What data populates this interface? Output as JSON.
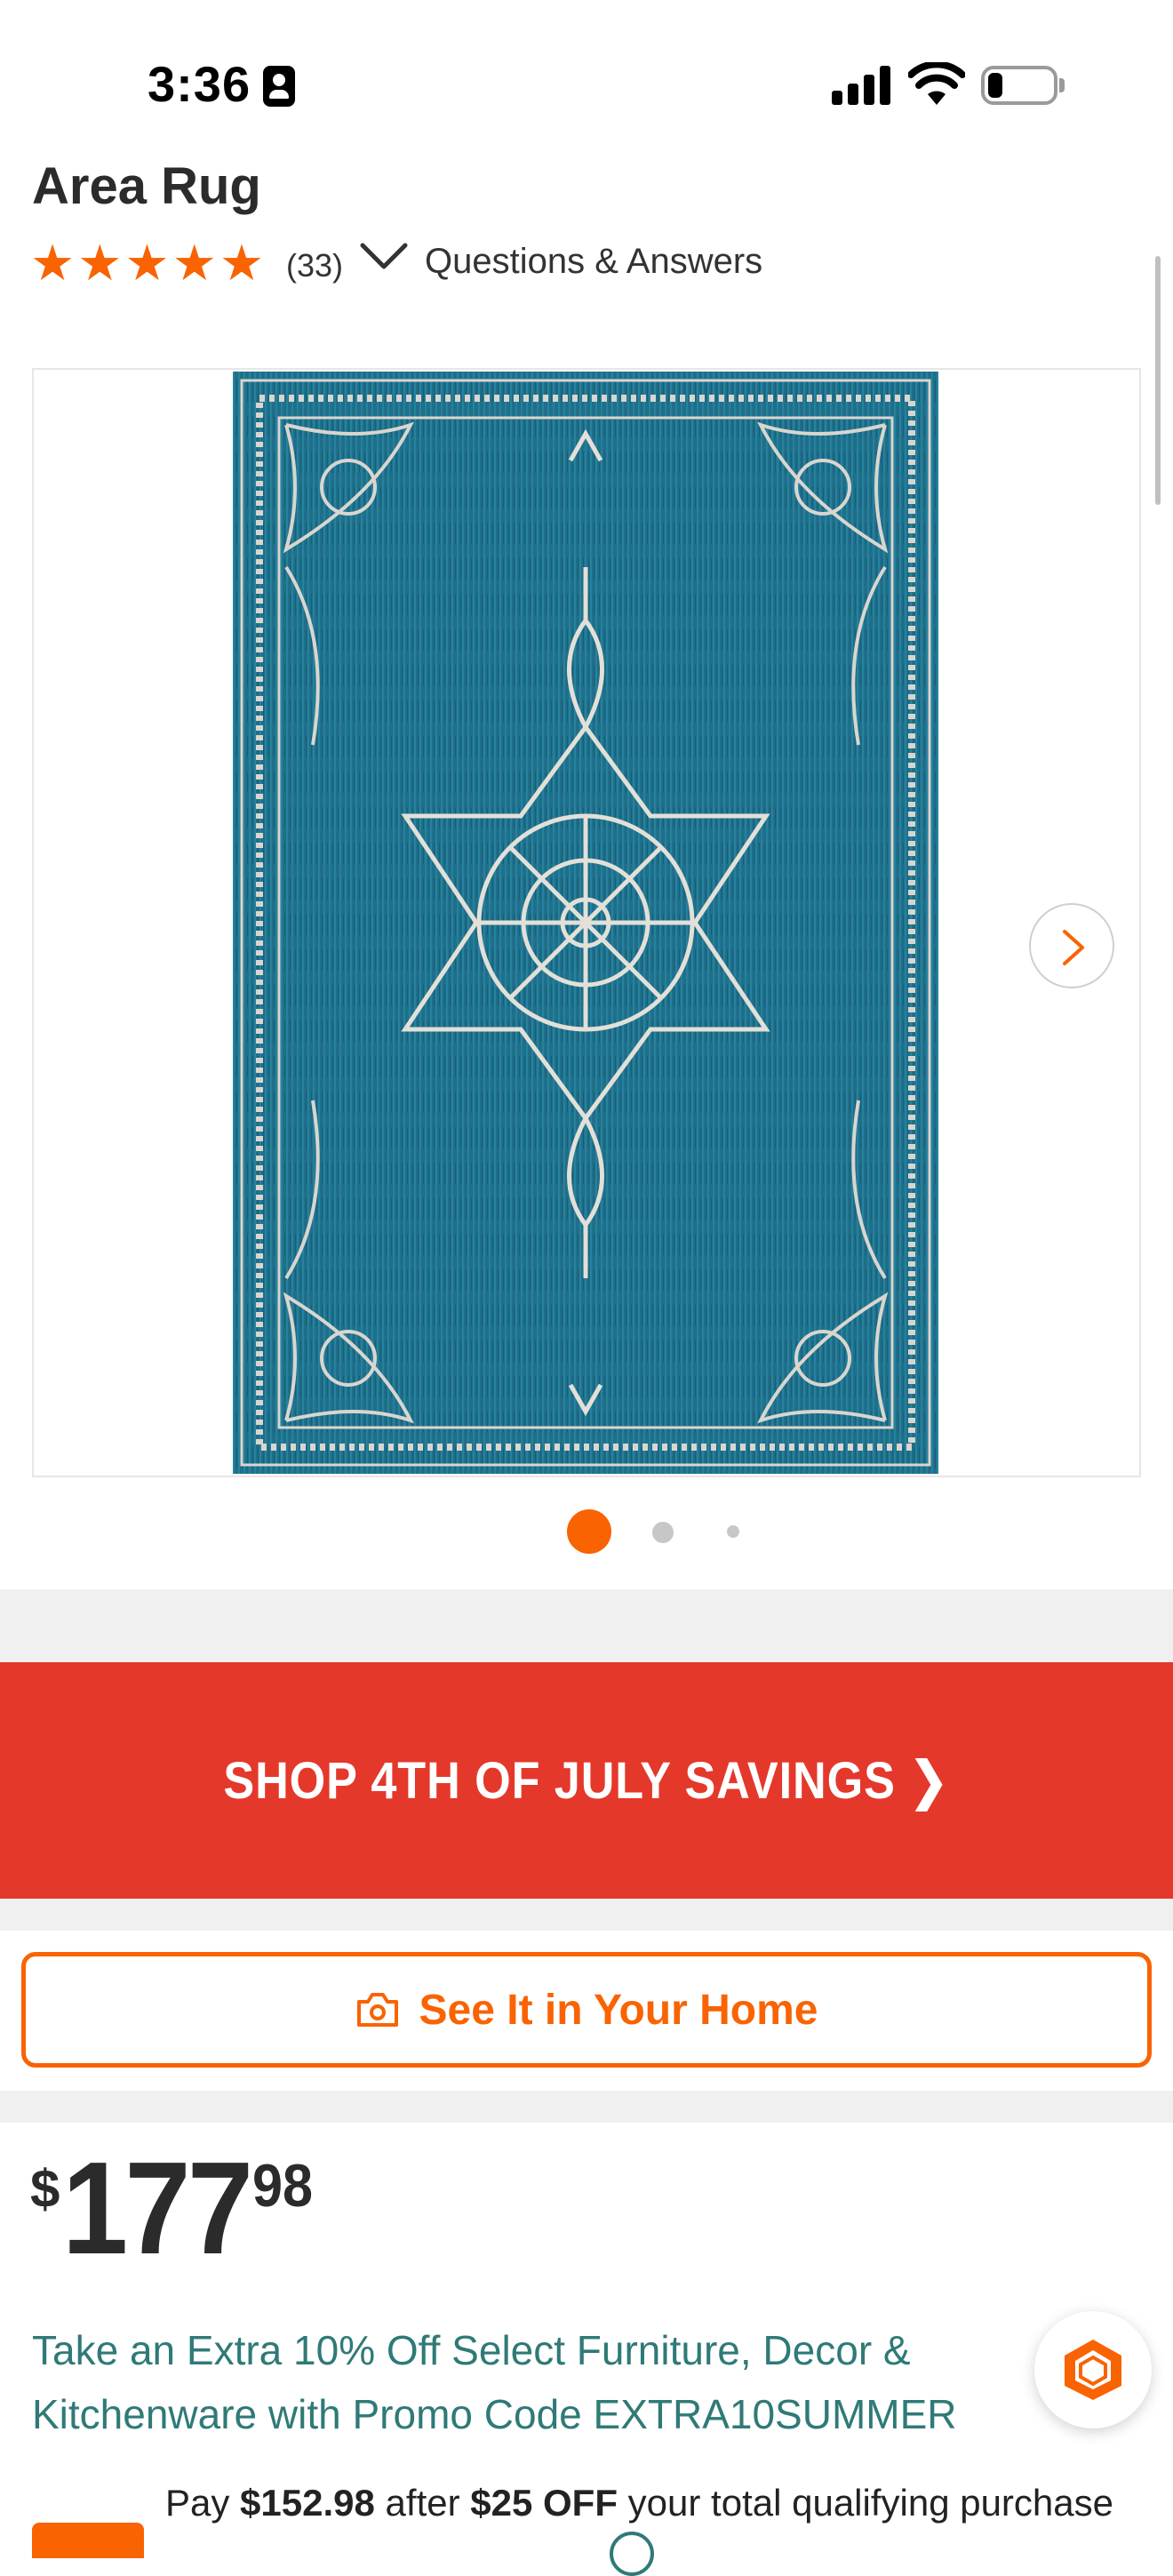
{
  "status_bar": {
    "time": "3:36"
  },
  "product": {
    "title": "Area Rug",
    "rating_stars": 5,
    "review_count": "(33)",
    "qa_link": "Questions & Answers"
  },
  "gallery": {
    "image_count": 3,
    "active_index": 0
  },
  "promo_banner": {
    "label": "SHOP 4TH OF JULY SAVINGS ❯"
  },
  "see_it_home": {
    "label": "See It in Your Home"
  },
  "price": {
    "currency": "$",
    "dollars": "177",
    "cents": "98"
  },
  "promo_message": "Take an Extra 10% Off Select Furniture, Decor & Kitchenware with Promo Code EXTRA10SUMMER",
  "financing": {
    "prefix": "Pay ",
    "amount": "$152.98",
    "middle": " after ",
    "discount": "$25 OFF",
    "suffix": " your total qualifying purchase"
  },
  "colors": {
    "accent": "#f96302",
    "banner": "#e4382b",
    "promo_text": "#2f7a77"
  }
}
